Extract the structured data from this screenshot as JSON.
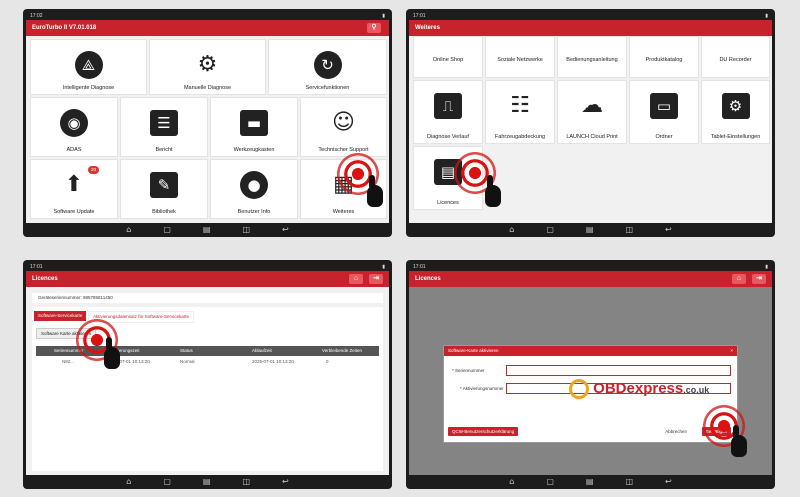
{
  "panel1": {
    "status_time": "17:02",
    "title": "EuroTurbo II V7.01.018",
    "tiles": [
      {
        "label": "Intelligente Diagnose",
        "icon": "diagnose-icon"
      },
      {
        "label": "Manuelle Diagnose",
        "icon": "mechanic-car-icon"
      },
      {
        "label": "Servicefunktionen",
        "icon": "service-wrench-icon"
      },
      {
        "label": "ADAS",
        "icon": "adas-car-icon"
      },
      {
        "label": "Bericht",
        "icon": "report-icon"
      },
      {
        "label": "Werkzeugkasten",
        "icon": "toolbox-icon"
      },
      {
        "label": "Technischer Support",
        "icon": "support-agent-icon"
      },
      {
        "label": "Software Update",
        "icon": "upload-arrow-icon",
        "badge": "20"
      },
      {
        "label": "Bibliothek",
        "icon": "library-edit-icon"
      },
      {
        "label": "Benutzer Info",
        "icon": "user-icon"
      },
      {
        "label": "Weiteres",
        "icon": "more-grid-icon"
      }
    ]
  },
  "panel2": {
    "status_time": "17:01",
    "title": "Weiteres",
    "top_row": [
      "Online Shop",
      "Soziale Netzwerke",
      "Bedienungsanleitung",
      "Produktkatalog",
      "DU Recorder"
    ],
    "tiles": [
      {
        "label": "Diagnose Verlauf",
        "icon": "history-chart-icon"
      },
      {
        "label": "Fahrzeugabdeckung",
        "icon": "coverage-list-icon"
      },
      {
        "label": "LAUNCH Cloud Print",
        "icon": "cloud-print-icon"
      },
      {
        "label": "Ordner",
        "icon": "folder-icon"
      },
      {
        "label": "Tablet-Einstellungen",
        "icon": "settings-gear-icon"
      },
      {
        "label": "Licences",
        "icon": "licence-card-icon"
      }
    ]
  },
  "panel3": {
    "status_time": "17:01",
    "title": "Licences",
    "serial": "Geräteseriennummer: 985785811450",
    "tab_active": "Software-Servicekarte",
    "tab_inactive": "Aktivierungsdatensatz für Software-Servicekarte",
    "activate_button": "Software Karte aktivieren",
    "columns": [
      "Seriennummer",
      "Aktivierungszeit",
      "Status",
      "Ablaufzeit",
      "Verbleibende Zeiten"
    ],
    "rows": [
      [
        "N82...",
        "2024-07-01 10:13:20",
        "Normal",
        "2025-07-01 10:13:20",
        "0"
      ]
    ]
  },
  "panel4": {
    "status_time": "17:01",
    "title": "Licences",
    "dialog_title": "Software-Karte aktivieren",
    "field1_label": "* Seriennummer",
    "field2_label": "* Aktivierungsnummer",
    "qr_button": "QCW-Benutzerschutzerklärung",
    "cancel_button": "Abbrechen",
    "ok_button": "Bestätigen",
    "watermark_site": "OBDexpress",
    "watermark_tld": ".co.uk"
  },
  "nav_icons": [
    "home-icon",
    "back-square-icon",
    "gallery-icon",
    "vci-icon",
    "return-icon"
  ]
}
